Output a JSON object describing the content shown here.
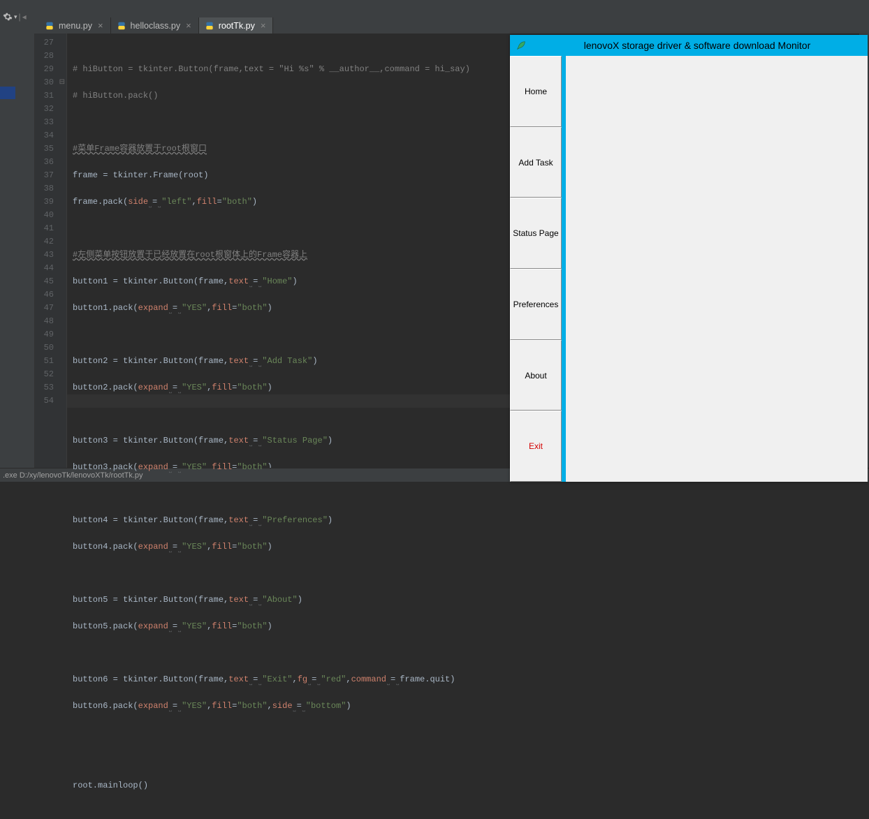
{
  "tabs": [
    {
      "label": "menu.py",
      "active": false
    },
    {
      "label": "helloclass.py",
      "active": false
    },
    {
      "label": "rootTk.py",
      "active": true
    }
  ],
  "line_start": 27,
  "line_end": 54,
  "current_line": 54,
  "code": {
    "l27": "# hiButton = tkinter.Button(frame,text = \"Hi %s\" % __author__,command = hi_say)",
    "l28": "# hiButton.pack()",
    "l30_cmt": "#菜单Frame容器放置于root根窗口",
    "l31a": "frame = tkinter.Frame(root)",
    "l32a": "frame.pack(",
    "l32_side": "side",
    "l32_eq": "=",
    "l32_left": "\"left\"",
    "l32_fill": "fill",
    "l32_both": "\"both\"",
    "l34_cmt": "#左侧菜单按钮放置于已经放置在root根窗体上的Frame容器上",
    "l35a": "button1 = tkinter.Button(frame,",
    "l35_text": "text",
    "l35_val": "\"Home\"",
    "l36a": "button1.pack(",
    "l36_expand": "expand",
    "l36_yes": "\"YES\"",
    "l36_fill": "fill",
    "l36_both": "\"both\"",
    "l38a": "button2 = tkinter.Button(frame,",
    "l38_val": "\"Add Task\"",
    "l39a": "button2.pack(",
    "l41a": "button3 = tkinter.Button(frame,",
    "l41_val": "\"Status Page\"",
    "l42a": "button3.pack(",
    "l44a": "button4 = tkinter.Button(frame,",
    "l44_val": "\"Preferences\"",
    "l45a": "button4.pack(",
    "l47a": "button5 = tkinter.Button(frame,",
    "l47_val": "\"About\"",
    "l48a": "button5.pack(",
    "l50a": "button6 = tkinter.Button(frame,",
    "l50_val": "\"Exit\"",
    "l50_fg": "fg",
    "l50_red": "\"red\"",
    "l50_cmd": "command",
    "l50_quit": "frame.quit)",
    "l51a": "button6.pack(",
    "l51_side": "side",
    "l51_bottom": "\"bottom\"",
    "l54a": "root.mainloop()"
  },
  "tk": {
    "title": "lenovoX storage driver & software download Monitor",
    "buttons": [
      "Home",
      "Add Task",
      "Status Page",
      "Preferences",
      "About",
      "Exit"
    ]
  },
  "status": ".exe D:/xy/lenovoTk/lenovoXTk/rootTk.py"
}
